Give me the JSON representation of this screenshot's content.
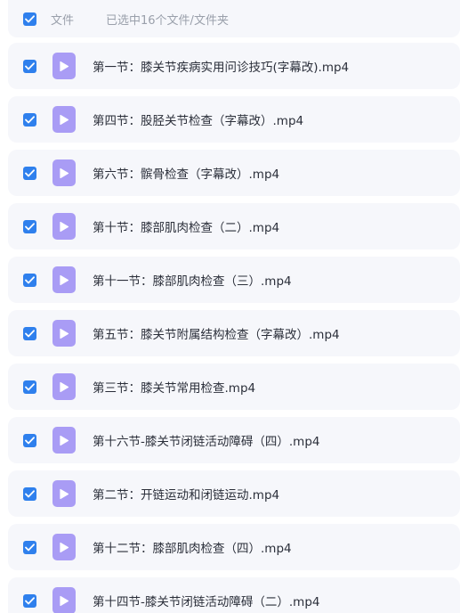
{
  "header": {
    "column_label": "文件",
    "selection_text": "已选中16个文件/文件夹"
  },
  "files": [
    {
      "name": "第一节：膝关节疾病实用问诊技巧(字幕改).mp4",
      "checked": true,
      "icon": "video-file-icon"
    },
    {
      "name": "第四节：股胫关节检查（字幕改）.mp4",
      "checked": true,
      "icon": "video-file-icon"
    },
    {
      "name": "第六节：髌骨检查（字幕改）.mp4",
      "checked": true,
      "icon": "video-file-icon"
    },
    {
      "name": "第十节：膝部肌肉检查（二）.mp4",
      "checked": true,
      "icon": "video-file-icon"
    },
    {
      "name": "第十一节：膝部肌肉检查（三）.mp4",
      "checked": true,
      "icon": "video-file-icon"
    },
    {
      "name": "第五节：膝关节附属结构检查（字幕改）.mp4",
      "checked": true,
      "icon": "video-file-icon"
    },
    {
      "name": "第三节：膝关节常用检查.mp4",
      "checked": true,
      "icon": "video-file-icon"
    },
    {
      "name": "第十六节-膝关节闭链活动障碍（四）.mp4",
      "checked": true,
      "icon": "video-file-icon"
    },
    {
      "name": "第二节：开链运动和闭链运动.mp4",
      "checked": true,
      "icon": "video-file-icon"
    },
    {
      "name": "第十二节：膝部肌肉检查（四）.mp4",
      "checked": true,
      "icon": "video-file-icon"
    },
    {
      "name": "第十四节-膝关节闭链活动障碍（二）.mp4",
      "checked": true,
      "icon": "video-file-icon"
    }
  ],
  "colors": {
    "checkbox": "#2f80ed",
    "row_background": "#f6f7fb",
    "file_icon": "#a99cf5",
    "text": "#2b2f3a",
    "muted_text": "#9aa0ab"
  }
}
